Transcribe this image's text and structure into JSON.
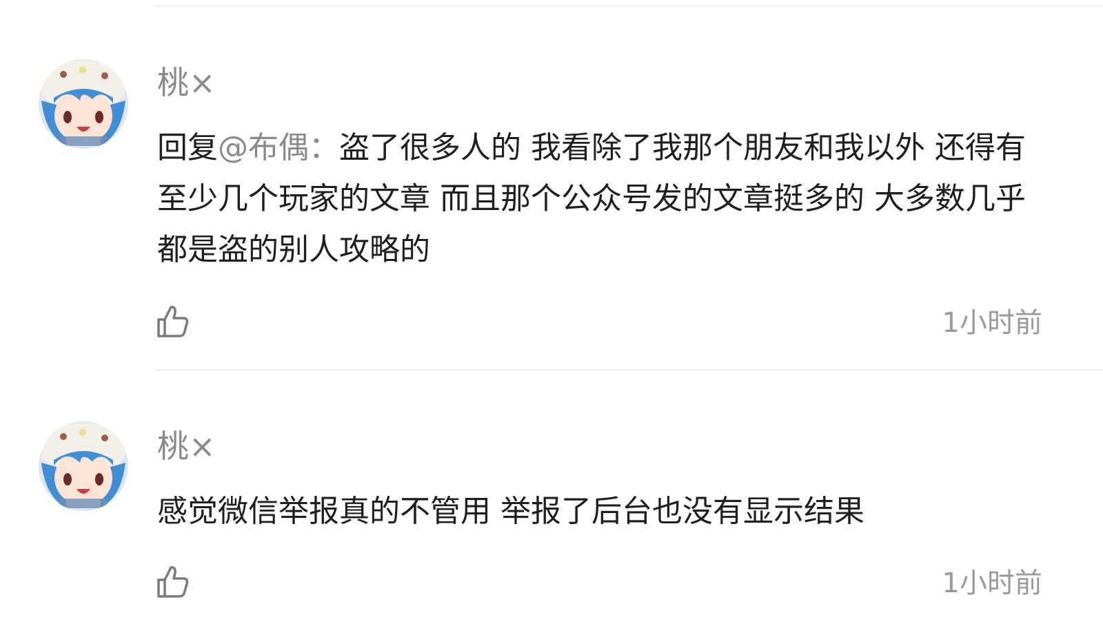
{
  "comments": [
    {
      "username": "桃×",
      "reply_prefix": "回复",
      "mention": "@布偶：",
      "text": "盗了很多人的 我看除了我那个朋友和我以外 还得有至少几个玩家的文章 而且那个公众号发的文章挺多的 大多数几乎都是盗的别人攻略的",
      "time": "1小时前",
      "like_icon": "thumbs-up-icon",
      "avatar_icon": "avatar-image"
    },
    {
      "username": "桃×",
      "text": "感觉微信举报真的不管用 举报了后台也没有显示结果",
      "time": "1小时前",
      "like_icon": "thumbs-up-icon",
      "avatar_icon": "avatar-image"
    }
  ],
  "colors": {
    "username": "#8a8a8a",
    "body_text": "#1f1f1f",
    "mention": "#8a8a8a",
    "time": "#9a9a9a",
    "divider": "#eeeeee"
  }
}
